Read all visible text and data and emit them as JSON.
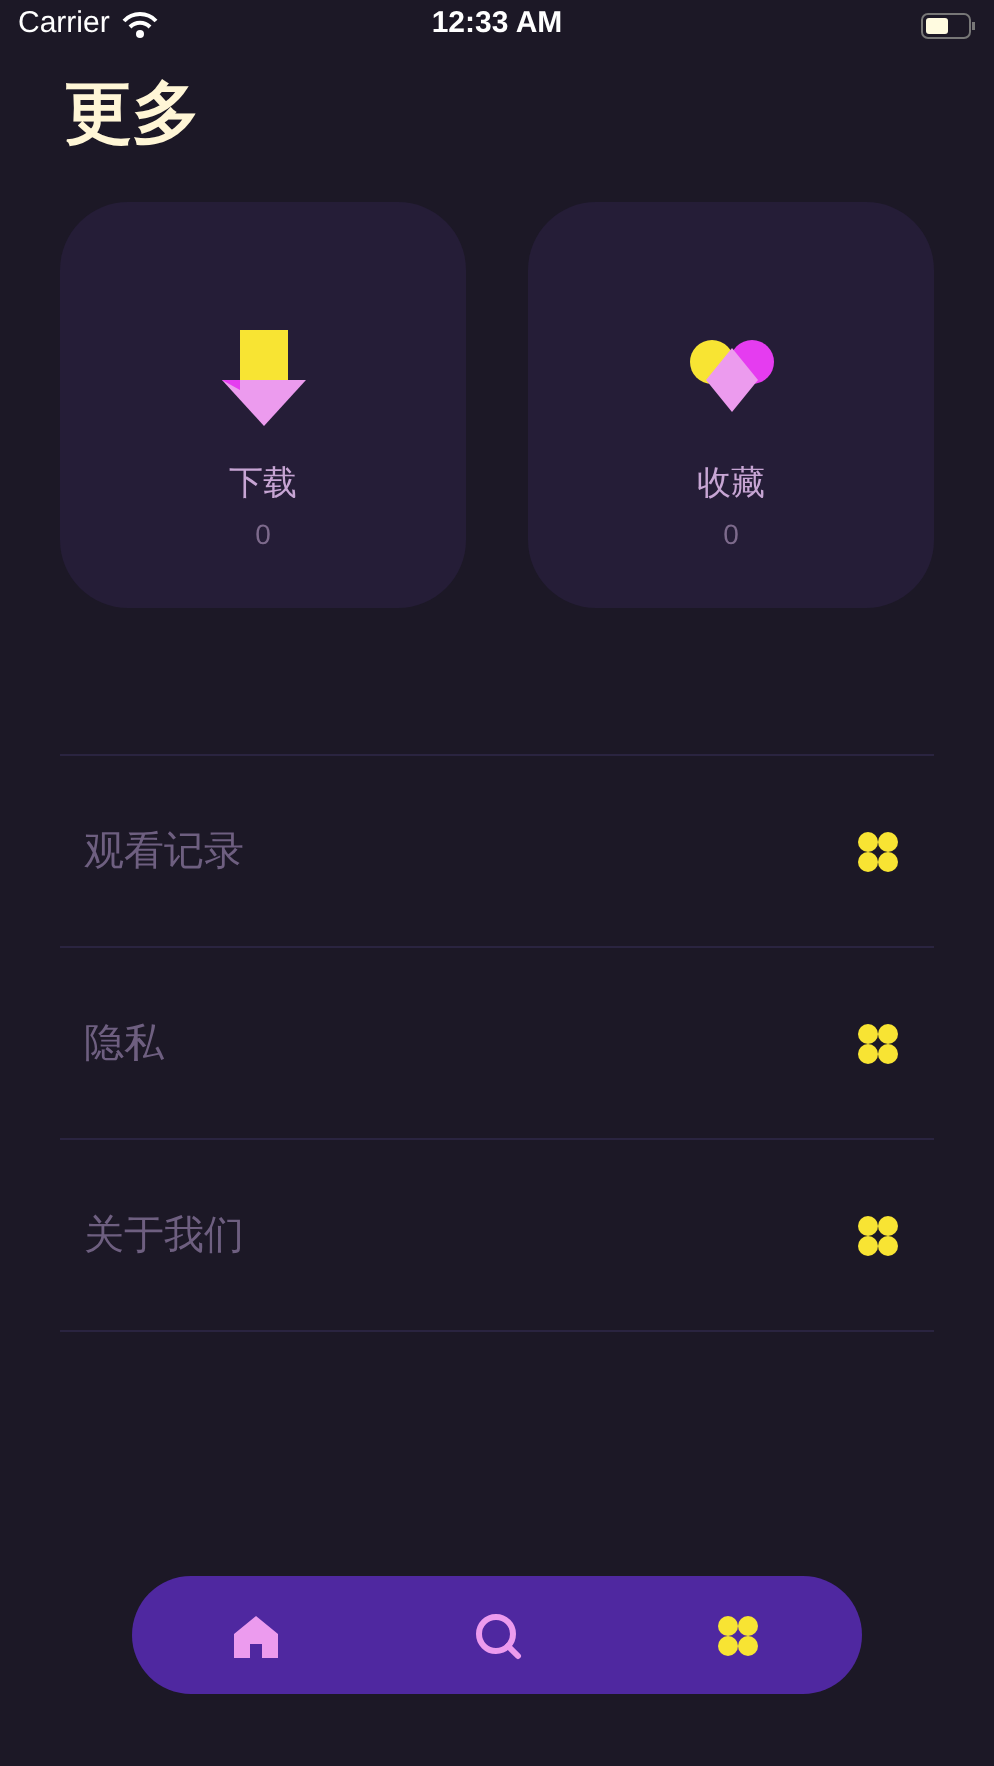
{
  "status_bar": {
    "carrier": "Carrier",
    "time": "12:33 AM"
  },
  "title": "更多",
  "cards": [
    {
      "kind": "download",
      "label": "下载",
      "count": "0"
    },
    {
      "kind": "favorite",
      "label": "收藏",
      "count": "0"
    }
  ],
  "menu": [
    {
      "label": "观看记录"
    },
    {
      "label": "隐私"
    },
    {
      "label": "关于我们"
    }
  ],
  "tabs": [
    {
      "kind": "home",
      "selected": false
    },
    {
      "kind": "search",
      "selected": false
    },
    {
      "kind": "more",
      "selected": true
    }
  ]
}
